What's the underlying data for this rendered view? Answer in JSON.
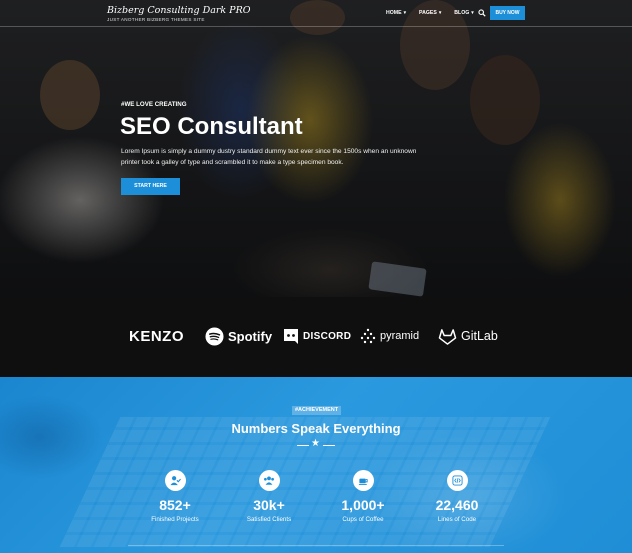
{
  "site": {
    "title": "Bizberg Consulting Dark PRO",
    "tagline": "JUST ANOTHER BIZBERG THEMES SITE"
  },
  "nav": {
    "items": [
      {
        "label": "HOME"
      },
      {
        "label": "PAGES"
      },
      {
        "label": "BLOG"
      }
    ],
    "buy_label": "BUY NOW"
  },
  "hero": {
    "eyebrow": "#WE LOVE CREATING",
    "title": "SEO Consultant",
    "description": "Lorem Ipsum is simply a dummy dustry standard dummy text ever since the 1500s when an unknown printer took a galley of type and scrambled it to make a type specimen book.",
    "cta_label": "START HERE"
  },
  "logos": [
    {
      "name": "KENZO",
      "icon": "kenzo-logo"
    },
    {
      "name": "Spotify",
      "icon": "spotify-icon"
    },
    {
      "name": "DISCORD",
      "icon": "discord-icon"
    },
    {
      "name": "pyramid",
      "icon": "pyramid-icon"
    },
    {
      "name": "GitLab",
      "icon": "gitlab-icon"
    }
  ],
  "achievements": {
    "badge": "#ACHIEVEMENT",
    "title": "Numbers Speak Everything",
    "stats": [
      {
        "value": "852+",
        "label": "Finished Projects",
        "icon": "user-check-icon"
      },
      {
        "value": "30k+",
        "label": "Satisfied Clients",
        "icon": "users-icon"
      },
      {
        "value": "1,000+",
        "label": "Cups of Coffee",
        "icon": "coffee-icon"
      },
      {
        "value": "22,460",
        "label": "Lines of Code",
        "icon": "code-icon"
      }
    ]
  },
  "colors": {
    "accent": "#1d8fd8",
    "stats_bg": "#2196dc",
    "logo_strip_bg": "#0f0f0f"
  }
}
